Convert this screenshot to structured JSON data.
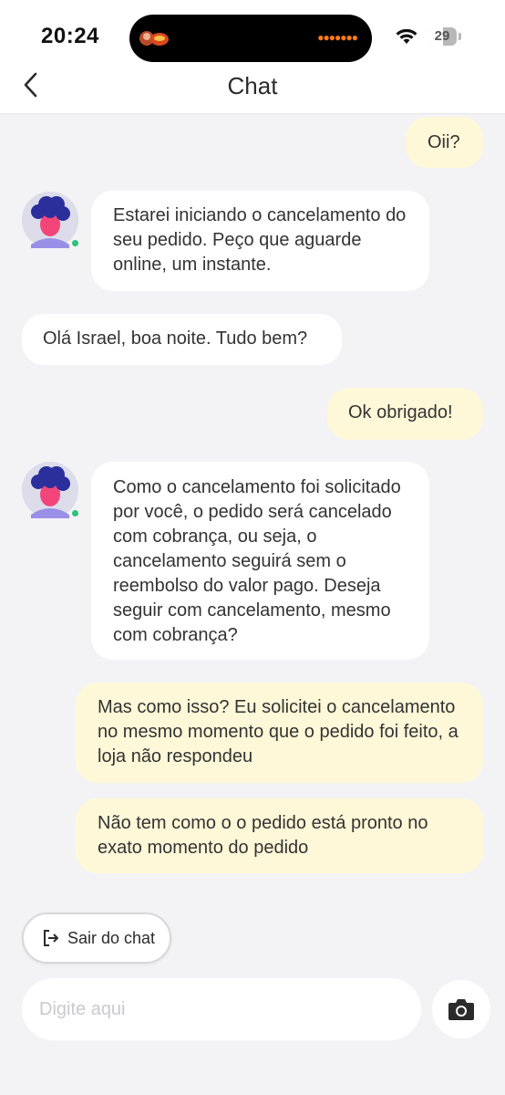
{
  "status_bar": {
    "time": "20:24",
    "battery_level": "29",
    "battery_percent": 29,
    "icons": [
      "wifi-icon",
      "battery-icon"
    ]
  },
  "header": {
    "title": "Chat",
    "back_icon": "chevron-left-icon"
  },
  "messages": [
    {
      "sender": "user",
      "text": "Oii?"
    },
    {
      "sender": "agent",
      "text": "Estarei iniciando o cancelamento do seu pedido. Peço que aguarde online, um instante."
    },
    {
      "sender": "agent",
      "text": "Olá Israel, boa noite. Tudo bem?"
    },
    {
      "sender": "user",
      "text": "Ok obrigado!"
    },
    {
      "sender": "agent",
      "text": "Como o cancelamento foi solicitado por você, o pedido será cancelado com cobrança, ou seja, o cancelamento seguirá sem o reembolso do valor pago. Deseja seguir com cancelamento, mesmo com cobrança?"
    },
    {
      "sender": "user",
      "text": "Mas como isso? Eu solicitei o cancelamento no mesmo momento que o pedido foi feito, a loja não respondeu"
    },
    {
      "sender": "user",
      "text": "Não tem como o o pedido está pronto no exato momento do pedido"
    }
  ],
  "actions": {
    "leave_chat_label": "Sair do chat",
    "leave_icon": "exit-icon"
  },
  "composer": {
    "placeholder": "Digite aqui",
    "value": "",
    "camera_icon": "camera-icon"
  },
  "colors": {
    "user_bubble": "#fff8d8",
    "agent_bubble": "#ffffff",
    "background": "#f3f3f5",
    "online_dot": "#2ec27e"
  }
}
